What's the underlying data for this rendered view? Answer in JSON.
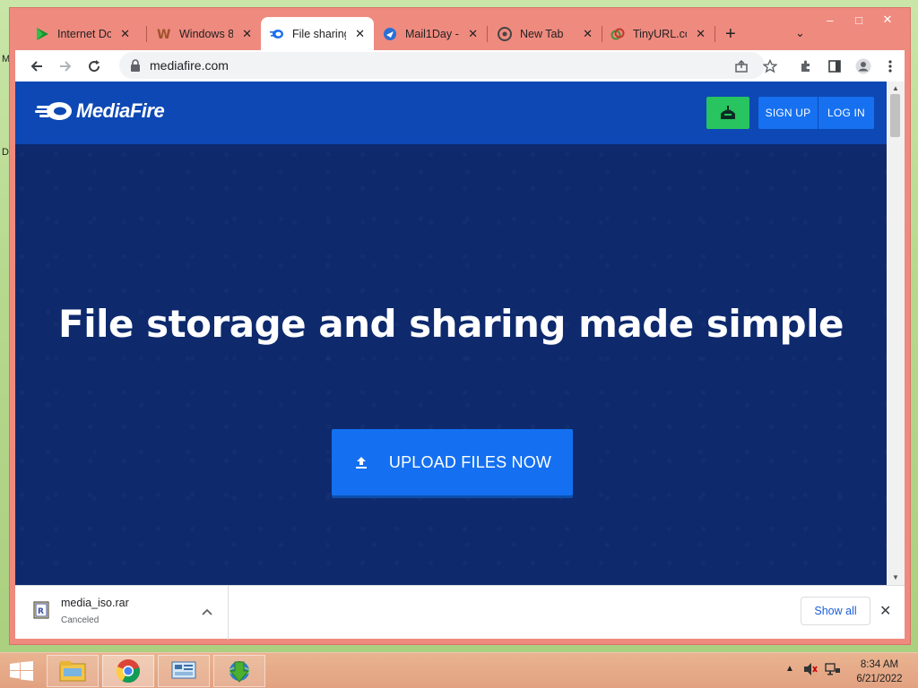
{
  "desktop": {
    "labels": [
      "M",
      "D"
    ]
  },
  "window": {
    "minimize": "–",
    "maximize": "□",
    "close": "✕"
  },
  "tabs": [
    {
      "title": "Internet Do",
      "icon": "idm-play-icon"
    },
    {
      "title": "Windows 8",
      "icon": "w-icon"
    },
    {
      "title": "File sharing",
      "icon": "mediafire-icon",
      "active": true
    },
    {
      "title": "Mail1Day -",
      "icon": "mail1day-icon"
    },
    {
      "title": "New Tab",
      "icon": "chrome-icon"
    },
    {
      "title": "TinyURL.co",
      "icon": "tinyurl-icon"
    }
  ],
  "tab_close": "✕",
  "new_tab": "+",
  "tab_menu": "⌄",
  "toolbar": {
    "url": "mediafire.com"
  },
  "mediafire": {
    "logo_text": "MediaFire",
    "signup": "SIGN UP",
    "login": "LOG IN",
    "hero_title": "File storage and sharing made simple",
    "upload_label": "UPLOAD FILES NOW"
  },
  "download": {
    "filename": "media_iso.rar",
    "status": "Canceled",
    "show_all": "Show all",
    "close": "✕"
  },
  "clock": {
    "time": "8:34 AM",
    "date": "6/21/2022"
  },
  "colors": {
    "window_frame": "#ef8a7f",
    "mf_header": "#0d48b4",
    "mf_hero": "#0e2a6d",
    "mf_button": "#1470f0",
    "mf_download_green": "#27c45f"
  }
}
